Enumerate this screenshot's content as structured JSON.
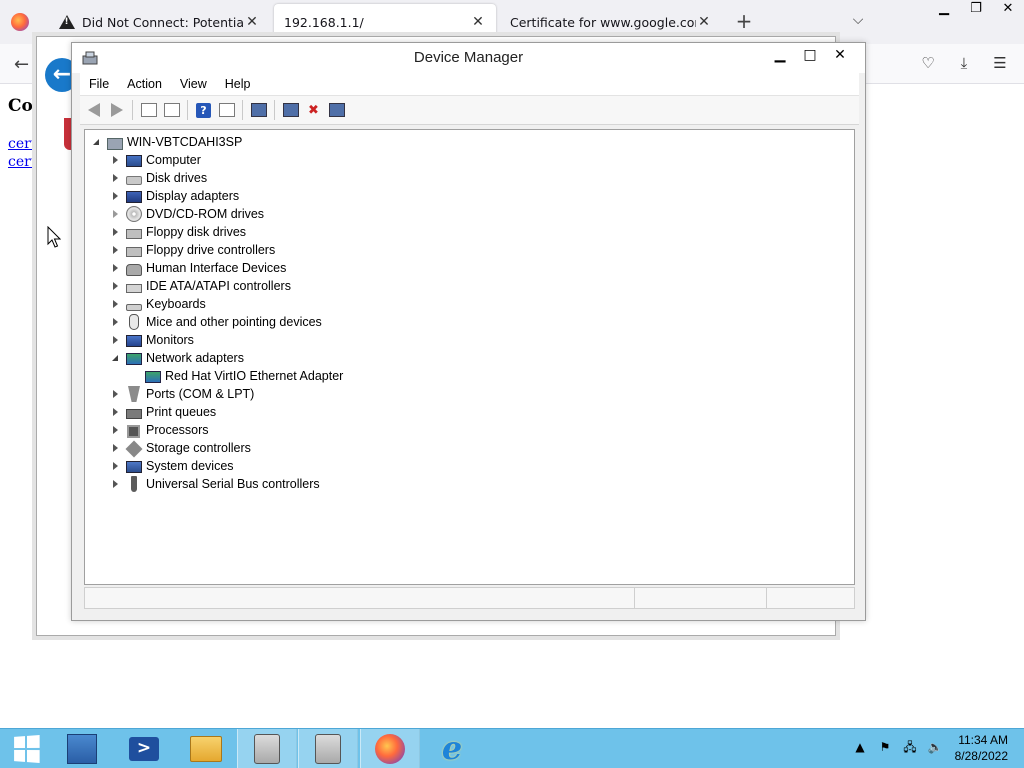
{
  "browser": {
    "tabs": [
      {
        "title": "Did Not Connect: Potential Security Issue",
        "active": false
      },
      {
        "title": "192.168.1.1/",
        "active": true
      },
      {
        "title": "Certificate for www.google.com",
        "active": false
      }
    ],
    "page": {
      "heading": "Col",
      "links": [
        "cert",
        "cert"
      ]
    }
  },
  "device_manager": {
    "title": "Device Manager",
    "menu": [
      "File",
      "Action",
      "View",
      "Help"
    ],
    "root": "WIN-VBTCDAHI3SP",
    "categories": [
      {
        "label": "Computer",
        "icon": "computer-icon",
        "expanded": false
      },
      {
        "label": "Disk drives",
        "icon": "disk-drive-icon",
        "expanded": false
      },
      {
        "label": "Display adapters",
        "icon": "display-adapter-icon",
        "expanded": false
      },
      {
        "label": "DVD/CD-ROM drives",
        "icon": "dvd-drive-icon",
        "expanded": false
      },
      {
        "label": "Floppy disk drives",
        "icon": "floppy-disk-icon",
        "expanded": false
      },
      {
        "label": "Floppy drive controllers",
        "icon": "floppy-controller-icon",
        "expanded": false
      },
      {
        "label": "Human Interface Devices",
        "icon": "hid-icon",
        "expanded": false
      },
      {
        "label": "IDE ATA/ATAPI controllers",
        "icon": "ide-controller-icon",
        "expanded": false
      },
      {
        "label": "Keyboards",
        "icon": "keyboard-icon",
        "expanded": false
      },
      {
        "label": "Mice and other pointing devices",
        "icon": "mouse-icon",
        "expanded": false
      },
      {
        "label": "Monitors",
        "icon": "monitor-icon",
        "expanded": false
      },
      {
        "label": "Network adapters",
        "icon": "network-adapter-icon",
        "expanded": true,
        "children": [
          "Red Hat VirtIO Ethernet Adapter"
        ]
      },
      {
        "label": "Ports (COM & LPT)",
        "icon": "port-icon",
        "expanded": false
      },
      {
        "label": "Print queues",
        "icon": "printer-icon",
        "expanded": false
      },
      {
        "label": "Processors",
        "icon": "processor-icon",
        "expanded": false
      },
      {
        "label": "Storage controllers",
        "icon": "storage-controller-icon",
        "expanded": false
      },
      {
        "label": "System devices",
        "icon": "system-device-icon",
        "expanded": false
      },
      {
        "label": "Universal Serial Bus controllers",
        "icon": "usb-icon",
        "expanded": false
      }
    ]
  },
  "taskbar": {
    "clock": {
      "time": "11:34 AM",
      "date": "8/28/2022"
    }
  },
  "colors": {
    "taskbar": "#6ec2ea",
    "link": "#0000ee",
    "ff_tabstrip": "#f0f0f4"
  }
}
